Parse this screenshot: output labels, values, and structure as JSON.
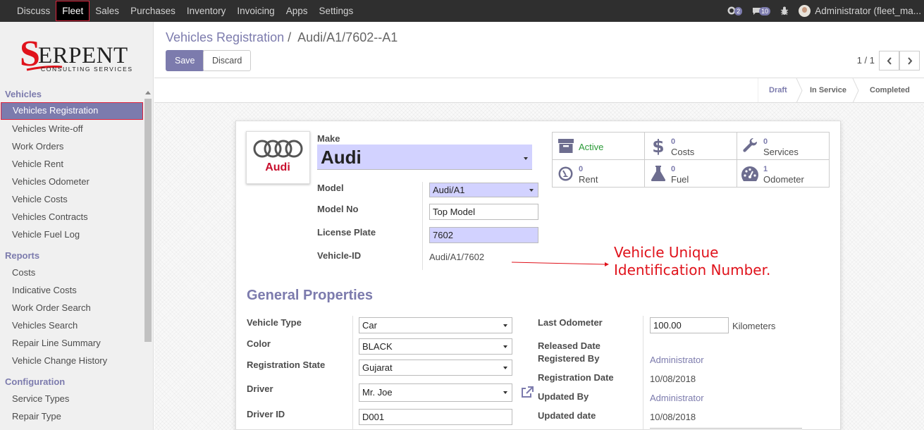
{
  "navbar": {
    "menus": [
      "Discuss",
      "Fleet",
      "Sales",
      "Purchases",
      "Inventory",
      "Invoicing",
      "Apps",
      "Settings"
    ],
    "active_menu": "Fleet",
    "chat_count": "2",
    "messages_count": "10",
    "user": "Administrator (fleet_ma..."
  },
  "sidebar": {
    "logo_main": "ERPENT",
    "logo_s": "S",
    "logo_sub": "CONSULTING SERVICES",
    "sections": [
      {
        "title": "Vehicles",
        "items": [
          "Vehicles Registration",
          "Vehicles Write-off",
          "Work Orders",
          "Vehicle Rent",
          "Vehicles Odometer",
          "Vehicle Costs",
          "Vehicles Contracts",
          "Vehicle Fuel Log"
        ]
      },
      {
        "title": "Reports",
        "items": [
          "Costs",
          "Indicative Costs",
          "Work Order Search",
          "Vehicles Search",
          "Repair Line Summary",
          "Vehicle Change History"
        ]
      },
      {
        "title": "Configuration",
        "items": [
          "Service Types",
          "Repair Type"
        ]
      }
    ]
  },
  "control_panel": {
    "breadcrumb_parent": "Vehicles Registration",
    "breadcrumb_sep": "/",
    "breadcrumb_current": "Audi/A1/7602--A1",
    "save_label": "Save",
    "discard_label": "Discard",
    "pager": "1 / 1"
  },
  "statusbar": {
    "stages": [
      "Draft",
      "In Service",
      "Completed"
    ],
    "current": "Draft"
  },
  "form": {
    "logo_text": "Audi",
    "make_label": "Make",
    "make_value": "Audi",
    "model_label": "Model",
    "model_value": "Audi/A1",
    "model_no_label": "Model No",
    "model_no_value": "Top Model",
    "license_plate_label": "License Plate",
    "license_plate_value": "7602",
    "vehicle_id_label": "Vehicle-ID",
    "vehicle_id_value": "Audi/A1/7602",
    "smart_buttons": {
      "active": {
        "label": "Active"
      },
      "costs": {
        "count": "0",
        "label": "Costs"
      },
      "services": {
        "count": "0",
        "label": "Services"
      },
      "rent": {
        "count": "0",
        "label": "Rent"
      },
      "fuel": {
        "count": "0",
        "label": "Fuel"
      },
      "odometer": {
        "count": "1",
        "label": "Odometer"
      }
    },
    "general_properties_title": "General Properties",
    "vehicle_type_label": "Vehicle Type",
    "vehicle_type_value": "Car",
    "color_label": "Color",
    "color_value": "BLACK",
    "registration_state_label": "Registration State",
    "registration_state_value": "Gujarat",
    "driver_label": "Driver",
    "driver_value": "Mr. Joe",
    "driver_id_label": "Driver ID",
    "driver_id_value": "D001",
    "last_odometer_label": "Last Odometer",
    "last_odometer_value": "100.00",
    "odometer_unit": "Kilometers",
    "released_date_label": "Released Date",
    "registered_by_label": "Registered By",
    "registered_by_value": "Administrator",
    "registration_date_label": "Registration Date",
    "registration_date_value": "10/08/2018",
    "updated_by_label": "Updated By",
    "updated_by_value": "Administrator",
    "updated_date_label": "Updated date",
    "updated_date_value": "10/08/2018"
  },
  "annotation": {
    "line1": "Vehicle Unique",
    "line2": "Identification Number."
  },
  "colors": {
    "brand": "#7c7bad",
    "navbar": "#2f2f2f",
    "required_field": "#d2d2ff",
    "annotation": "#e0121b",
    "active_green": "#2a9a37"
  }
}
